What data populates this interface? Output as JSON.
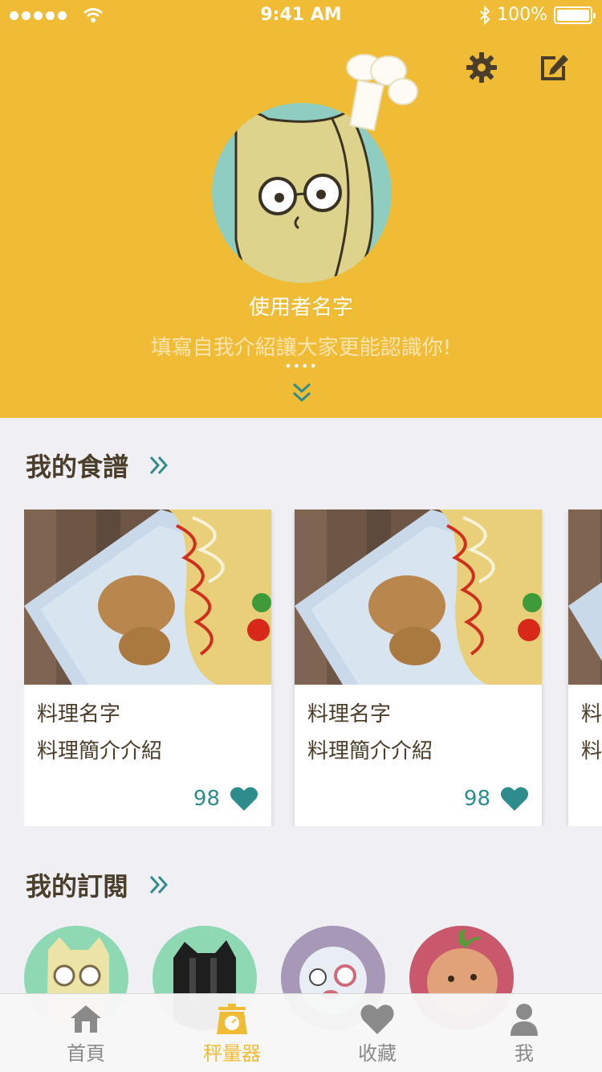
{
  "status_bar": {
    "time": "9:41 AM",
    "battery": "100%"
  },
  "profile": {
    "username": "使用者名字",
    "bio": "填寫自我介紹讓大家更能認識你!",
    "more": "••••"
  },
  "icons": {
    "settings": "gear-icon",
    "edit": "edit-icon",
    "expand": "chevron-double-down-icon",
    "like": "heart-icon"
  },
  "colors": {
    "brand": "#f0bc35",
    "accent": "#2e8d8c",
    "text": "#4a3e2b"
  },
  "my_recipes": {
    "title": "我的食譜",
    "cards": [
      {
        "name": "料理名字",
        "desc": "料理簡介介紹",
        "likes": "98"
      },
      {
        "name": "料理名字",
        "desc": "料理簡介介紹",
        "likes": "98"
      },
      {
        "name": "料",
        "desc": "料",
        "likes": ""
      }
    ]
  },
  "my_subscriptions": {
    "title": "我的訂閱"
  },
  "tab_bar": {
    "items": [
      {
        "label": "首頁",
        "icon": "home-icon"
      },
      {
        "label": "秤量器",
        "icon": "scale-icon",
        "active": true
      },
      {
        "label": "收藏",
        "icon": "heart-icon"
      },
      {
        "label": "我",
        "icon": "user-icon"
      }
    ]
  }
}
